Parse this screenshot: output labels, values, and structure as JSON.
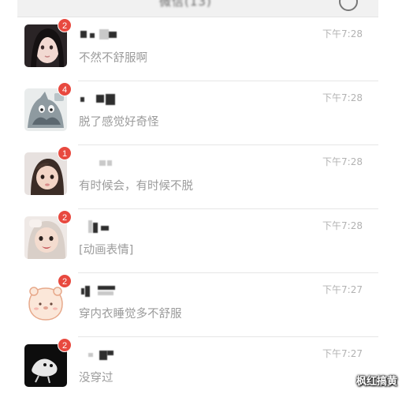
{
  "header": {
    "title": "微信(13)",
    "plus_icon": "plus-circle-icon"
  },
  "chats": [
    {
      "badge": "2",
      "time": "下午7:28",
      "message": "不然不舒服啊"
    },
    {
      "badge": "4",
      "time": "下午7:28",
      "message": "脱了感觉好奇怪"
    },
    {
      "badge": "1",
      "time": "下午7:28",
      "message": "有时候会，有时候不脱"
    },
    {
      "badge": "2",
      "time": "下午7:28",
      "message": "[动画表情]"
    },
    {
      "badge": "2",
      "time": "下午7:27",
      "message": "穿内衣睡觉多不舒服"
    },
    {
      "badge": "2",
      "time": "下午7:27",
      "message": "没穿过"
    }
  ],
  "watermark": "枫红搞黄"
}
